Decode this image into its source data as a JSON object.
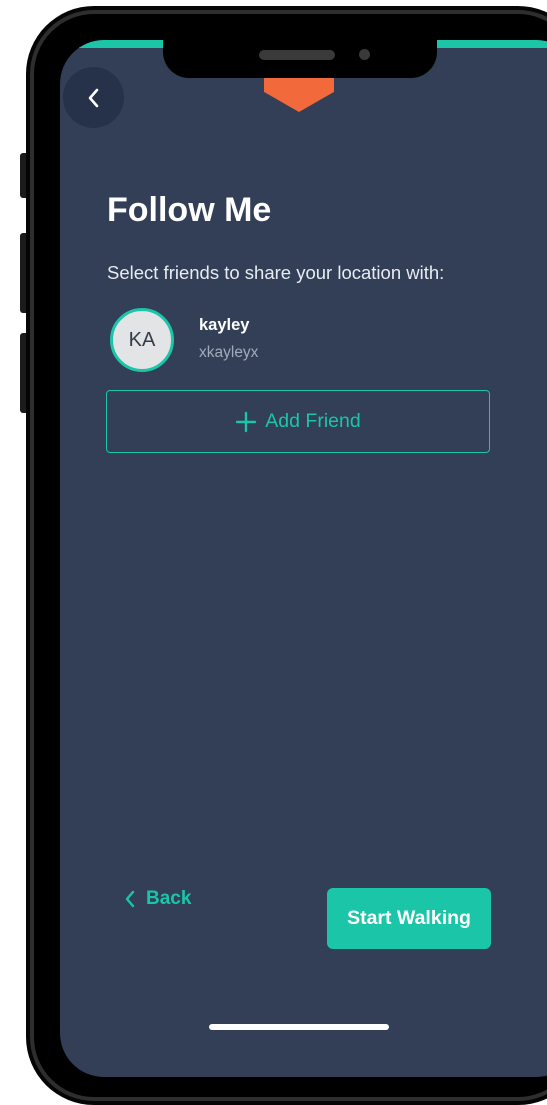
{
  "screen": {
    "title": "Follow Me",
    "subtitle": "Select friends to share your location with:"
  },
  "friends": [
    {
      "initials": "KA",
      "name": "kayley",
      "handle": "xkayleyx"
    }
  ],
  "actions": {
    "add_friend_label": "Add Friend",
    "back_label": "Back",
    "start_label": "Start Walking"
  },
  "icons": {
    "top_back": "chevron-left-icon",
    "add": "plus-icon",
    "bottom_back": "chevron-left-icon"
  },
  "colors": {
    "background": "#323f56",
    "accent": "#1ac5a8",
    "brand": "#f26a3c"
  }
}
